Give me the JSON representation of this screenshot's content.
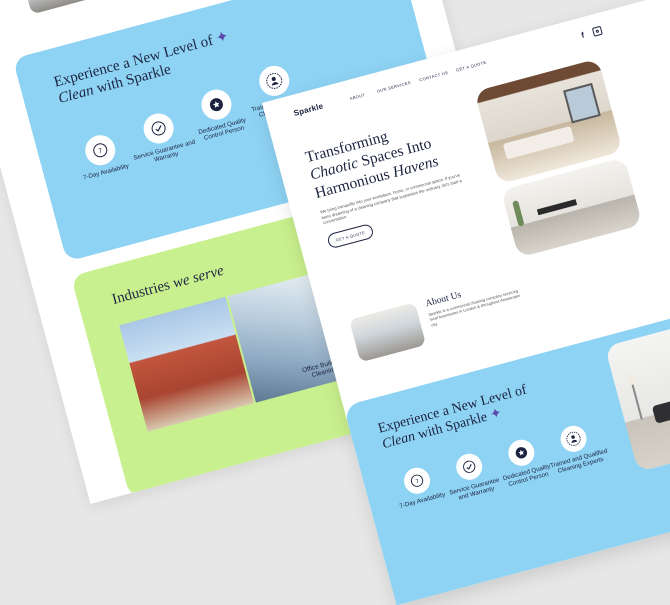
{
  "about": {
    "heading": "About Us",
    "body": "Sparkle is a commercial cleaning company servicing local businesses in London & throughout Amsterdam city."
  },
  "nav": {
    "logo": "Sparkle",
    "links": [
      "ABOUT",
      "OUR SERVICES",
      "CONTACT US"
    ],
    "cta": "GET A QUOTE"
  },
  "social": [
    "facebook-icon",
    "instagram-icon"
  ],
  "hero": {
    "title_line1": "Transforming",
    "title_italic1": "Chaotic",
    "title_line2": " Spaces Into",
    "title_line3": "Harmonious ",
    "title_italic2": "Havens",
    "body": "We bring tranquility into your workplace, home, or commercial space. If you've been dreaming of a cleaning company that surpasses the ordinary, let's start a conversation.",
    "cta": "GET A QUOTE"
  },
  "experience": {
    "title_line1": "Experience a New Level of",
    "title_italic": "Clean",
    "title_line2": " with Sparkle",
    "features": [
      {
        "label": "7-Day Availability",
        "icon": "calendar-icon"
      },
      {
        "label": "Service Guarantee and Warranty",
        "icon": "badge-check-icon"
      },
      {
        "label": "Dedicated Quality Control Person",
        "icon": "star-icon"
      },
      {
        "label": "Trained and Qualified Cleaning Experts",
        "icon": "sparkle-person-icon"
      }
    ]
  },
  "industries": {
    "title": "Industries ",
    "title_italic": "we serve",
    "items": [
      "Office Building Cleaning"
    ]
  },
  "colors": {
    "blue": "#8fd3f4",
    "green": "#c9f08e",
    "navy": "#1c2340",
    "purple": "#5b4aa8"
  }
}
